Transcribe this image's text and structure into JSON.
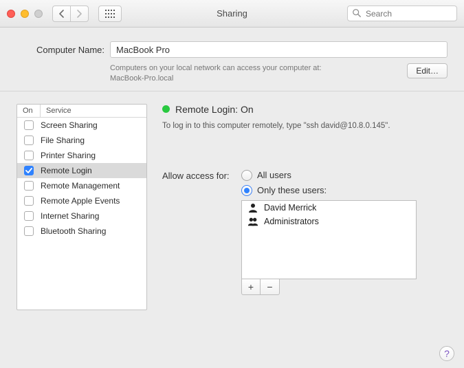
{
  "window": {
    "title": "Sharing"
  },
  "search": {
    "placeholder": "Search"
  },
  "computer_name": {
    "label": "Computer Name:",
    "value": "MacBook Pro",
    "subtext_line1": "Computers on your local network can access your computer at:",
    "subtext_line2": "MacBook-Pro.local",
    "edit_button": "Edit…"
  },
  "service_panel": {
    "col_on": "On",
    "col_service": "Service",
    "items": [
      {
        "label": "Screen Sharing",
        "checked": false,
        "selected": false
      },
      {
        "label": "File Sharing",
        "checked": false,
        "selected": false
      },
      {
        "label": "Printer Sharing",
        "checked": false,
        "selected": false
      },
      {
        "label": "Remote Login",
        "checked": true,
        "selected": true
      },
      {
        "label": "Remote Management",
        "checked": false,
        "selected": false
      },
      {
        "label": "Remote Apple Events",
        "checked": false,
        "selected": false
      },
      {
        "label": "Internet Sharing",
        "checked": false,
        "selected": false
      },
      {
        "label": "Bluetooth Sharing",
        "checked": false,
        "selected": false
      }
    ]
  },
  "detail": {
    "status_title": "Remote Login: On",
    "status_color": "#29c940",
    "hint": "To log in to this computer remotely, type \"ssh david@10.8.0.145\".",
    "access_label": "Allow access for:",
    "radio_all": "All users",
    "radio_only": "Only these users:",
    "selected_radio": "only",
    "users": [
      {
        "label": "David Merrick",
        "icon": "person"
      },
      {
        "label": "Administrators",
        "icon": "group"
      }
    ],
    "plus": "+",
    "minus": "−"
  },
  "help_label": "?"
}
